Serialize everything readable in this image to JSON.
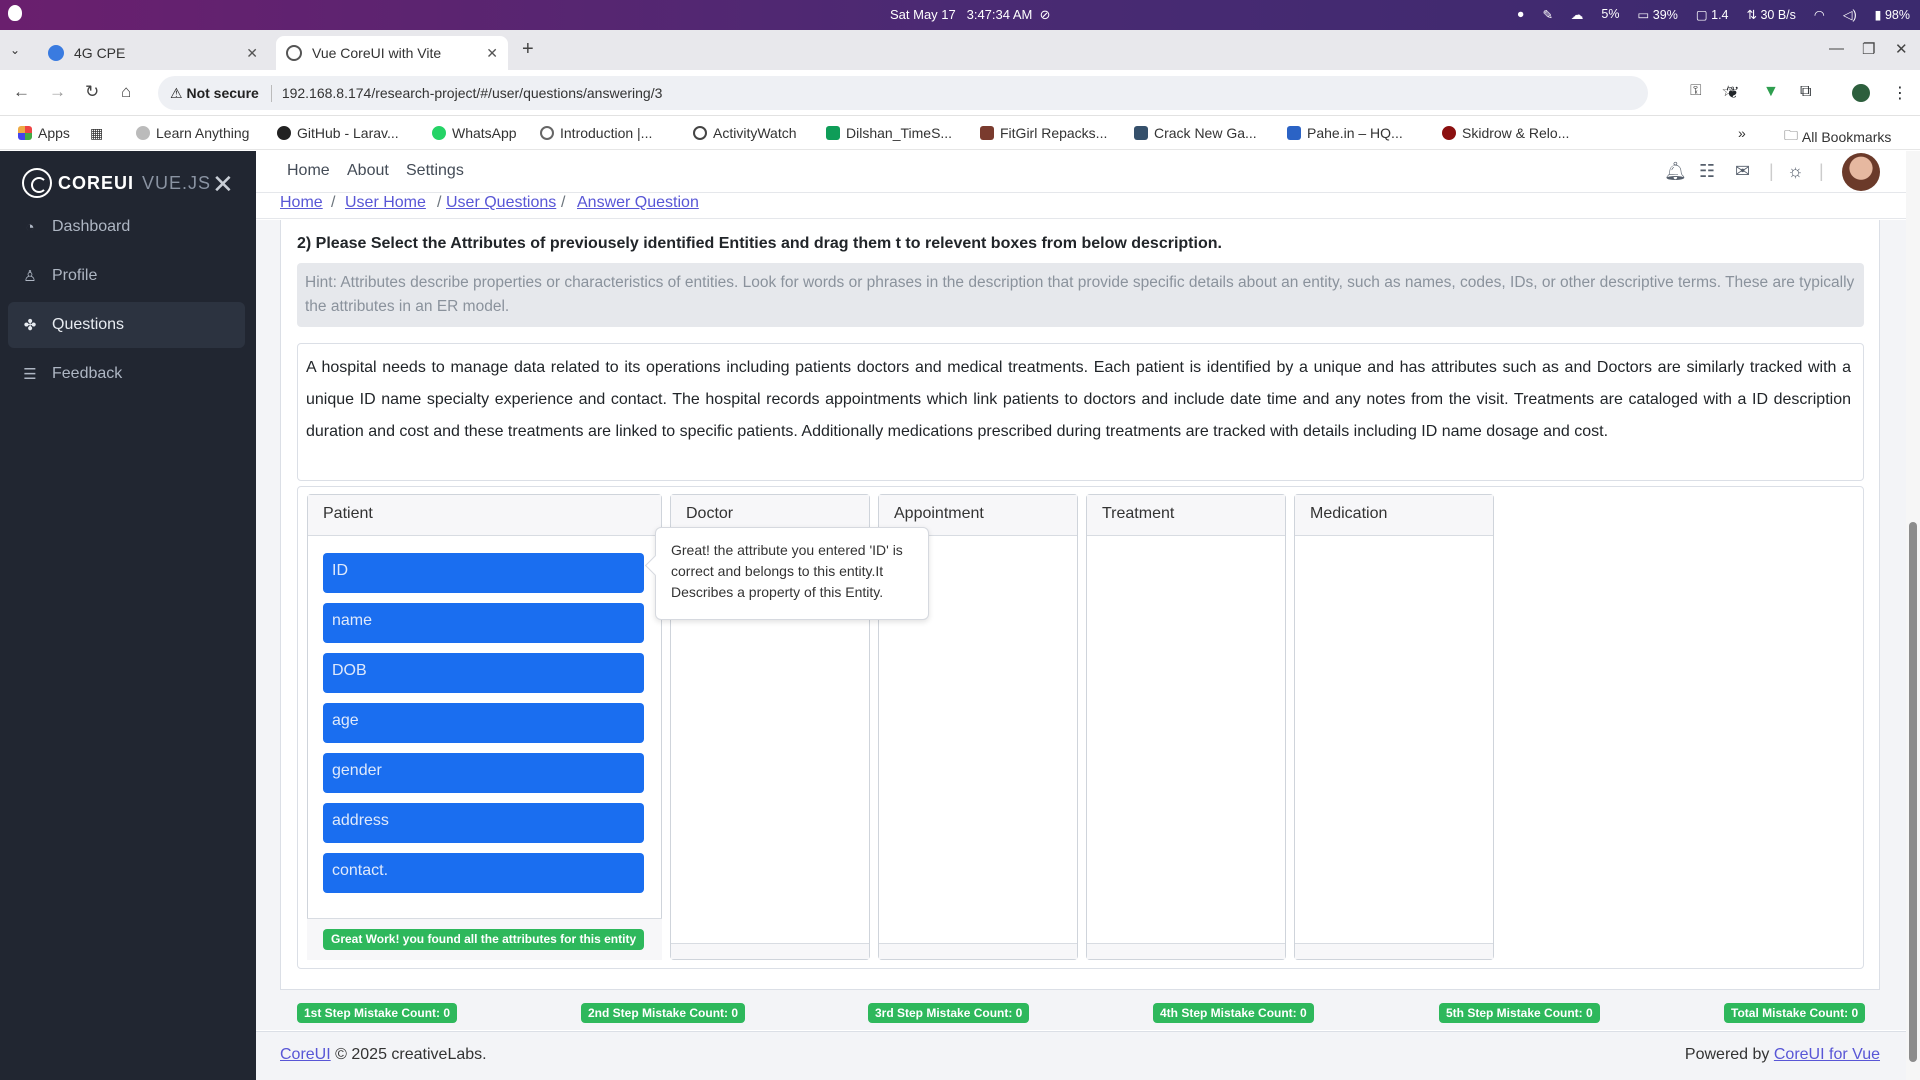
{
  "os": {
    "date": "Sat May 17",
    "time": "3:47:34 AM",
    "cpu": "5%",
    "battery_label": "39%",
    "load": "1.4",
    "net": "30 B/s",
    "power": "98%"
  },
  "browser": {
    "tabs": [
      {
        "title": "4G CPE",
        "active": false
      },
      {
        "title": "Vue CoreUI with Vite",
        "active": true
      }
    ],
    "security": "Not secure",
    "url": "192.168.8.174/research-project/#/user/questions/answering/3",
    "bookmarks": [
      "Apps",
      "Learn Anything",
      "GitHub - Larav...",
      "WhatsApp",
      "Introduction |...",
      "ActivityWatch",
      "Dilshan_TimeS...",
      "FitGirl Repacks...",
      "Crack New Ga...",
      "Pahe.in – HQ...",
      "Skidrow & Relo..."
    ],
    "all_bookmarks": "All Bookmarks"
  },
  "sidebar": {
    "brand_main": "COREUI",
    "brand_sub": "VUE.JS",
    "items": [
      {
        "label": "Dashboard",
        "icon": "speedometer-icon"
      },
      {
        "label": "Profile",
        "icon": "user-icon"
      },
      {
        "label": "Questions",
        "icon": "puzzle-icon"
      },
      {
        "label": "Feedback",
        "icon": "list-icon"
      }
    ]
  },
  "header": {
    "nav": [
      "Home",
      "About",
      "Settings"
    ]
  },
  "breadcrumb": [
    "Home",
    "User Home",
    "User Questions",
    "Answer Question"
  ],
  "question": {
    "title": "2) Please Select the Attributes of previousely identified Entities and drag them t to relevent boxes from below description.",
    "hint": "Hint: Attributes describe properties or characteristics of entities. Look for words or phrases in the description that provide specific details about an entity, such as names, codes, IDs, or other descriptive terms. These are typically the attributes in an ER model.",
    "description": "A hospital needs to manage data related to its operations  including patients  doctors  and medical treatments. Each patient is identified by a unique and has attributes such as       and Doctors are similarly tracked with a unique ID  name  specialty  experience  and contact. The hospital records appointments  which link patients to doctors and include date  time  and any notes from the visit. Treatments are cataloged with a ID  description  duration  and cost  and these treatments are linked to specific patients. Additionally  medications prescribed during treatments are tracked with details including ID  name  dosage  and cost."
  },
  "entities": [
    {
      "name": "Patient",
      "attributes": [
        "ID",
        "name",
        "DOB",
        "age",
        "gender",
        "address",
        "contact."
      ],
      "status": "Great Work! you found all the attributes for this entity"
    },
    {
      "name": "Doctor",
      "attributes": []
    },
    {
      "name": "Appointment",
      "attributes": []
    },
    {
      "name": "Treatment",
      "attributes": []
    },
    {
      "name": "Medication",
      "attributes": []
    }
  ],
  "tooltip": "Great! the attribute you entered 'ID' is correct and belongs to this entity.It Describes a property of this Entity.",
  "mistakes": [
    "1st Step Mistake Count: 0",
    "2nd Step Mistake Count: 0",
    "3rd Step Mistake Count: 0",
    "4th Step Mistake Count: 0",
    "5th Step Mistake Count: 0",
    "Total Mistake Count: 0"
  ],
  "footer": {
    "left_link": "CoreUI",
    "left_text": "© 2025 creativeLabs.",
    "right_text": "Powered by",
    "right_link": "CoreUI for Vue"
  },
  "colors": {
    "sidebar_bg": "#212631",
    "attribute_bg": "#1a6ef0",
    "success": "#2eb85c",
    "link": "#5856d6"
  }
}
